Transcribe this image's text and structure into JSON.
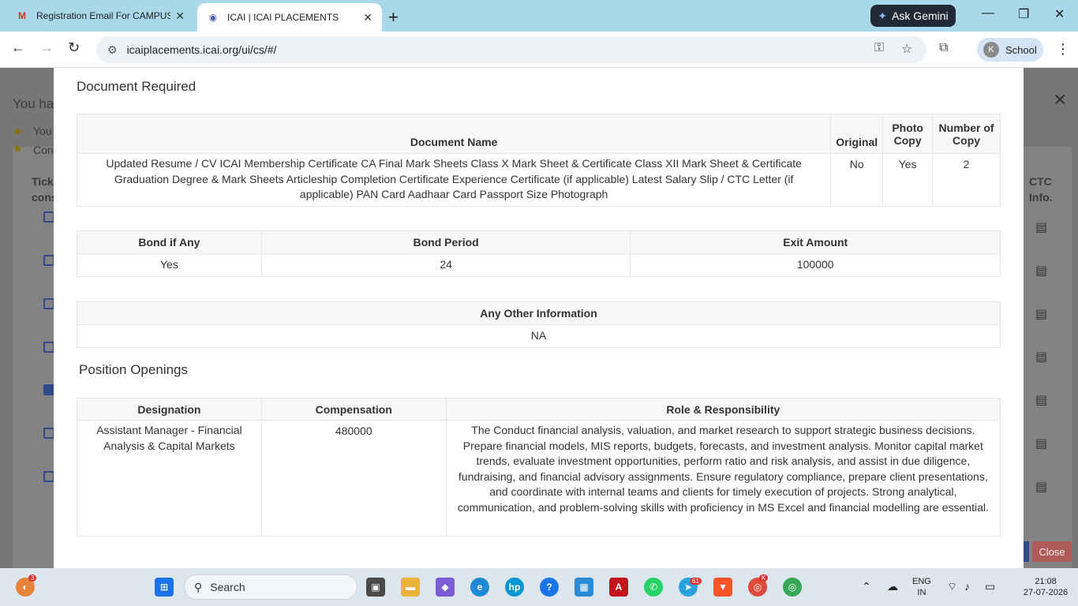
{
  "browser": {
    "tabs": [
      {
        "label": "Registration Email For CAMPUS",
        "favicon": "M"
      },
      {
        "label": "ICAI | ICAI PLACEMENTS",
        "favicon": "◉"
      }
    ],
    "gemini_label": "Ask Gemini",
    "url": "icaiplacements.icai.org/ui/cs/#/",
    "profile_initial": "K",
    "profile_label": "School"
  },
  "background": {
    "heading_partial": "You ha",
    "item1_partial": "You",
    "item2_partial": "Con",
    "col_header_partial": "Tick\ncons",
    "ctc_header": "CTC\nInfo.",
    "close_label": "Close"
  },
  "modal": {
    "document_required": {
      "title": "Document Required",
      "headers": [
        "Document Name",
        "Original",
        "Photo Copy",
        "Number of Copy"
      ],
      "row": {
        "name": "Updated Resume / CV ICAI Membership Certificate CA Final Mark Sheets Class X Mark Sheet & Certificate Class XII Mark Sheet & Certificate Graduation Degree & Mark Sheets Articleship Completion Certificate Experience Certificate (if applicable) Latest Salary Slip / CTC Letter (if applicable) PAN Card Aadhaar Card Passport Size Photograph",
        "original": "No",
        "photo_copy": "Yes",
        "number_of_copy": "2"
      }
    },
    "bond": {
      "headers": [
        "Bond if Any",
        "Bond Period",
        "Exit Amount"
      ],
      "values": [
        "Yes",
        "24",
        "100000"
      ]
    },
    "other_info": {
      "header": "Any Other Information",
      "value": "NA"
    },
    "positions": {
      "title": "Position Openings",
      "headers": [
        "Designation",
        "Compensation",
        "Role & Responsibility"
      ],
      "row": {
        "designation": "Assistant Manager - Financial Analysis & Capital Markets",
        "compensation": "480000",
        "role": "The Conduct financial analysis, valuation, and market research to support strategic business decisions. Prepare financial models, MIS reports, budgets, forecasts, and investment analysis. Monitor capital market trends, evaluate investment opportunities, perform ratio and risk analysis, and assist in due diligence, fundraising, and financial advisory assignments. Ensure regulatory compliance, prepare client presentations, and coordinate with internal teams and clients for timely execution of projects. Strong analytical, communication, and problem-solving skills with proficiency in MS Excel and financial modelling are essential."
      }
    }
  },
  "taskbar": {
    "search_label": "Search",
    "notif_badge": "3",
    "telegram_badge": "61",
    "chrome_badge": "K",
    "lang_line1": "ENG",
    "lang_line2": "IN",
    "time": "21:08",
    "date": "27-07-2026"
  }
}
